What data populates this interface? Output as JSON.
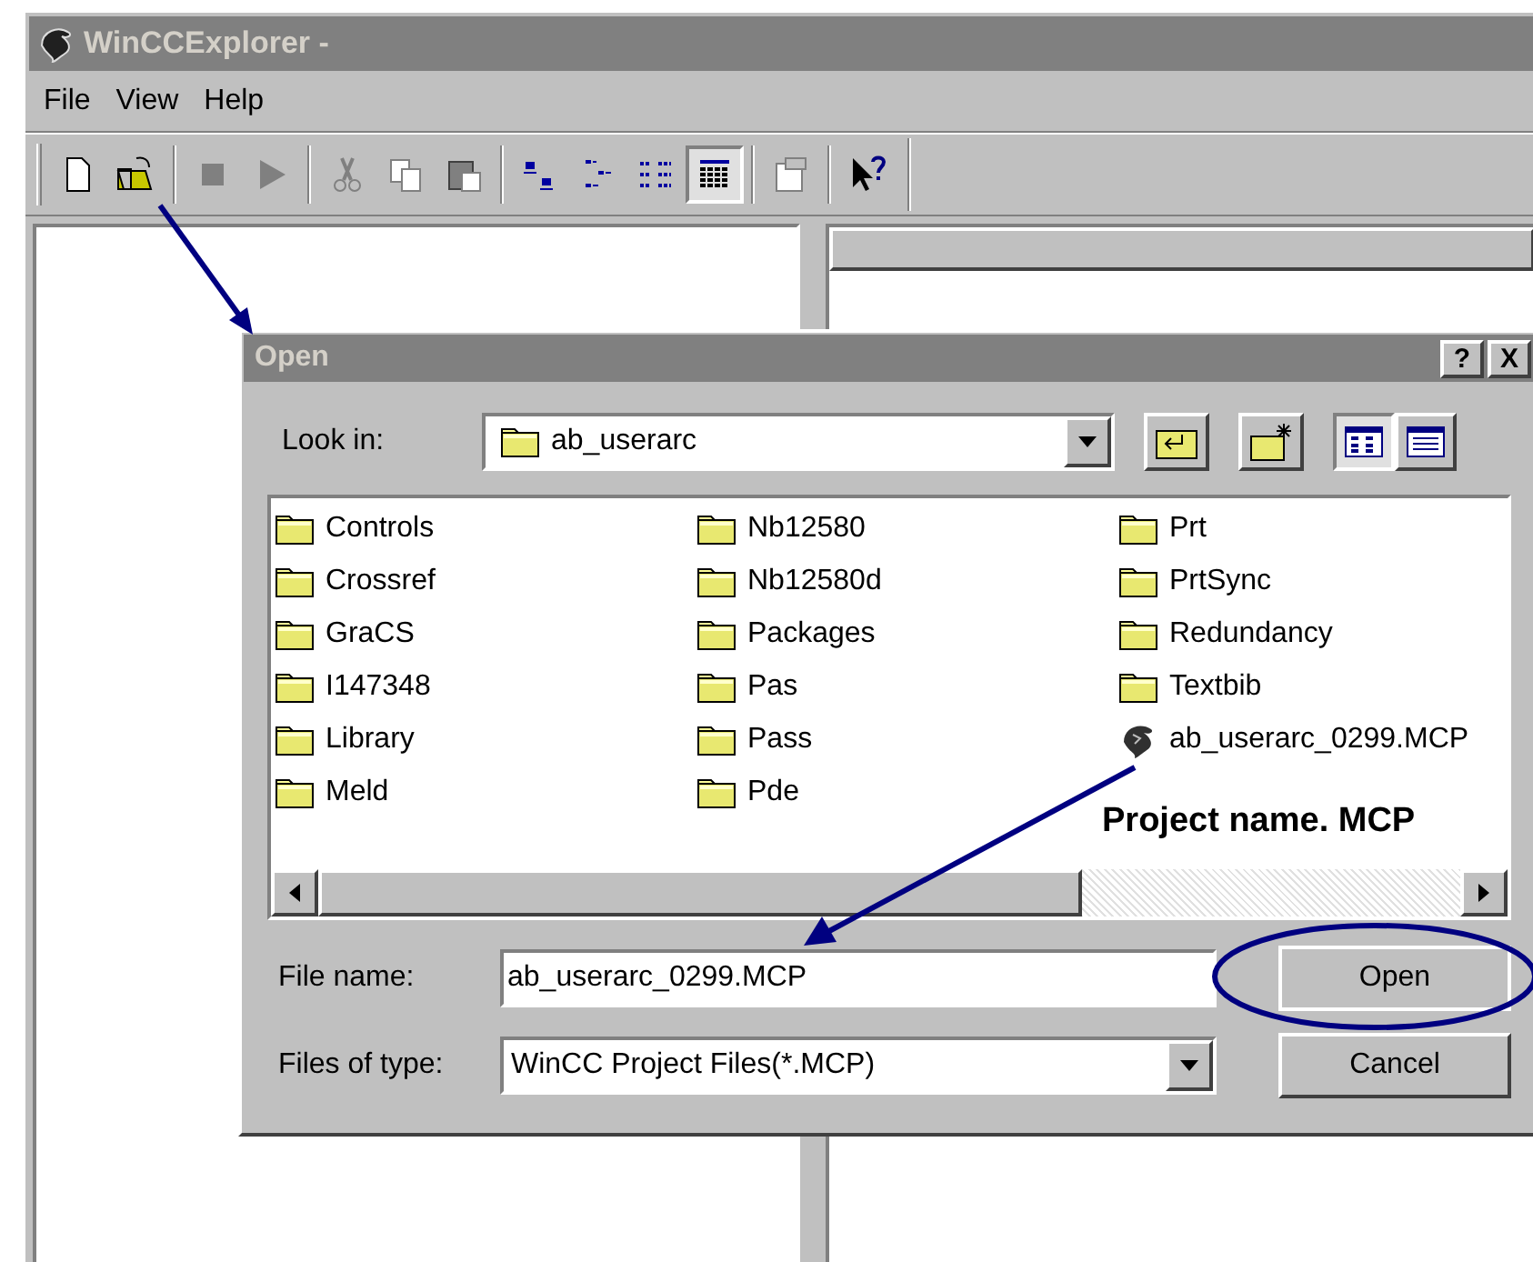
{
  "window": {
    "title": "WinCCExplorer -"
  },
  "menu": [
    "File",
    "View",
    "Help"
  ],
  "toolbar_views": [
    {
      "selected": false
    },
    {
      "selected": false
    },
    {
      "selected": false
    },
    {
      "selected": true
    }
  ],
  "dialog": {
    "title": "Open",
    "help_button": "?",
    "close_button": "X",
    "look_in": {
      "label": "Look in:",
      "value": "ab_userarc"
    },
    "view_buttons": [
      {
        "selected": true
      },
      {
        "selected": false
      }
    ],
    "files": [
      {
        "name": "Controls",
        "kind": "folder"
      },
      {
        "name": "Crossref",
        "kind": "folder"
      },
      {
        "name": "GraCS",
        "kind": "folder"
      },
      {
        "name": "I147348",
        "kind": "folder"
      },
      {
        "name": "Library",
        "kind": "folder"
      },
      {
        "name": "Meld",
        "kind": "folder"
      },
      {
        "name": "Nb12580",
        "kind": "folder"
      },
      {
        "name": "Nb12580d",
        "kind": "folder"
      },
      {
        "name": "Packages",
        "kind": "folder"
      },
      {
        "name": "Pas",
        "kind": "folder"
      },
      {
        "name": "Pass",
        "kind": "folder"
      },
      {
        "name": "Pde",
        "kind": "folder"
      },
      {
        "name": "Prt",
        "kind": "folder"
      },
      {
        "name": "PrtSync",
        "kind": "folder"
      },
      {
        "name": "Redundancy",
        "kind": "folder"
      },
      {
        "name": "Textbib",
        "kind": "folder"
      },
      {
        "name": "ab_userarc_0299.MCP",
        "kind": "project"
      }
    ],
    "file_name": {
      "label": "File name:",
      "value": "ab_userarc_0299.MCP"
    },
    "file_type": {
      "label": "Files of type:",
      "value": "WinCC Project Files(*.MCP)"
    },
    "buttons": [
      "Open",
      "Cancel"
    ]
  },
  "annotation": {
    "text": "Project name. MCP"
  }
}
